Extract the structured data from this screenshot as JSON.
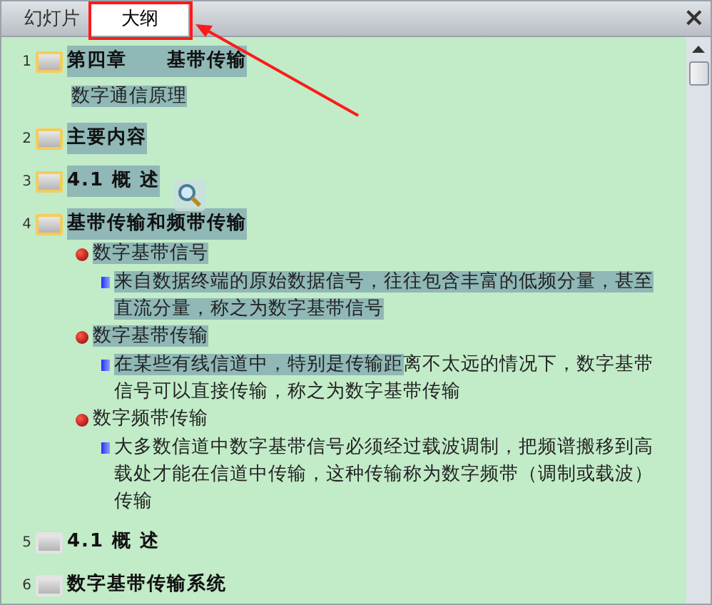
{
  "tabs": [
    {
      "label": "幻灯片",
      "selected": false
    },
    {
      "label": "大纲",
      "selected": true
    }
  ],
  "close": "×",
  "slides": [
    {
      "number": "1",
      "title": "第四章　　基带传输",
      "selected": true,
      "subtitle": "数字通信原理"
    },
    {
      "number": "2",
      "title": "主要内容",
      "selected": true
    },
    {
      "number": "3",
      "title": "4.1 概 述",
      "selected": true
    },
    {
      "number": "4",
      "title": "基带传输和频带传输",
      "selected": true,
      "bullets": [
        {
          "segments": [
            {
              "text": "数字基带信号",
              "selected": true
            }
          ],
          "children": [
            {
              "segments": [
                {
                  "text": "来自数据终端的原始数据信号，往往包含丰富的低频分量，甚至直流分量，称之为数字基带信号",
                  "selected": true
                }
              ]
            }
          ]
        },
        {
          "segments": [
            {
              "text": "数字基带传输",
              "selected": true
            }
          ],
          "children": [
            {
              "segments": [
                {
                  "text": "在某些有线信道中，特别是传输距",
                  "selected": true
                },
                {
                  "text": "离不太远的情况下，数字基带信号可以直接传输，称之为数字基带传输",
                  "selected": false
                }
              ]
            }
          ]
        },
        {
          "segments": [
            {
              "text": "数字频带传输",
              "selected": false
            }
          ],
          "children": [
            {
              "segments": [
                {
                  "text": "大多数信道中数字基带信号必须经过载波调制，把频谱搬移到高载处才能在信道中传输，这种传输称为数字频带（调制或载波）传输",
                  "selected": false
                }
              ]
            }
          ]
        }
      ]
    },
    {
      "number": "5",
      "title": "4.1 概 述",
      "selected": false
    },
    {
      "number": "6",
      "title": "数字基带传输系统",
      "selected": false
    }
  ]
}
